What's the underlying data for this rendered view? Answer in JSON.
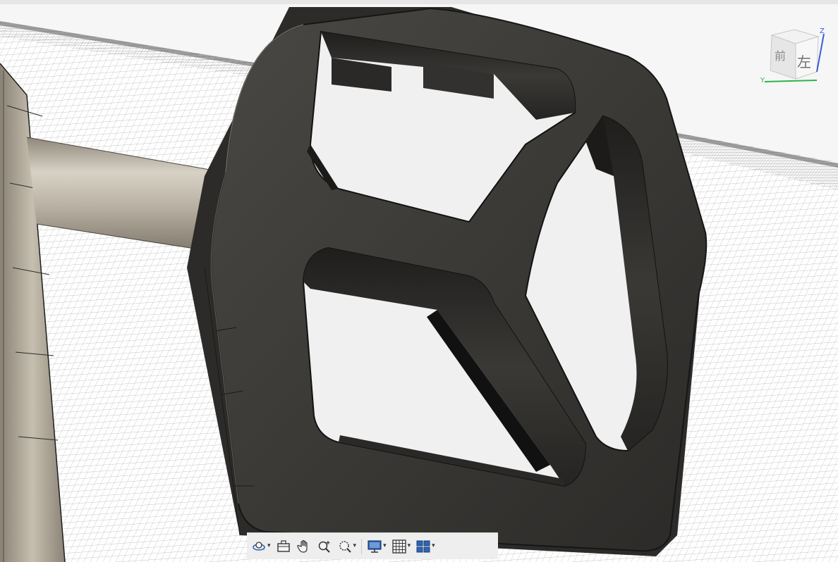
{
  "app": {
    "view": "3D model viewport"
  },
  "viewcube": {
    "face_front_label": "左",
    "face_side_label": "前",
    "axis_z_label": "Z",
    "axis_y_label": "Y",
    "axis_colors": {
      "z": "#3b5bdb",
      "y": "#2fb34a",
      "x": "#d9482b"
    }
  },
  "toolbar": {
    "buttons": [
      {
        "name": "orbit",
        "icon": "orbit-icon",
        "has_dropdown": true
      },
      {
        "name": "look-at",
        "icon": "look-at-icon",
        "has_dropdown": false
      },
      {
        "name": "pan",
        "icon": "pan-hand-icon",
        "has_dropdown": false
      },
      {
        "name": "zoom",
        "icon": "zoom-icon",
        "has_dropdown": false
      },
      {
        "name": "fit",
        "icon": "zoom-window-icon",
        "has_dropdown": true
      },
      {
        "name": "display-settings",
        "icon": "display-monitor-icon",
        "has_dropdown": true
      },
      {
        "name": "grid-settings",
        "icon": "grid-icon",
        "has_dropdown": true
      },
      {
        "name": "viewports",
        "icon": "viewports-icon",
        "has_dropdown": true
      }
    ],
    "caret": "▾"
  },
  "colors": {
    "model_dark": "#3c3a37",
    "model_inner": "#2a2927",
    "axle_metal": "#b9b2a4",
    "ground_grid_line": "#9a9a9a",
    "toolbar_icon_blue": "#2c64b8"
  }
}
